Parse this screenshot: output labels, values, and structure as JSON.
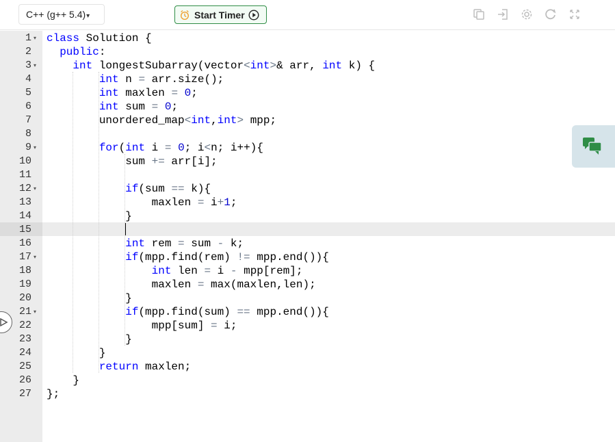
{
  "toolbar": {
    "language": "C++ (g++ 5.4)",
    "language_caret": "▾",
    "timer_label": "Start Timer",
    "icons": [
      "copy-icon",
      "signin-icon",
      "settings-icon",
      "reset-icon",
      "fullscreen-icon"
    ]
  },
  "colors": {
    "keyword": "#0000ff",
    "number": "#0000cd",
    "operator": "#687687",
    "accent_green": "#2f8d46",
    "chat_green": "#2f8d46"
  },
  "editor": {
    "active_line": 15,
    "lines": [
      {
        "n": "1",
        "fold": true,
        "code": "class Solution {"
      },
      {
        "n": "2",
        "fold": false,
        "code": "  public:"
      },
      {
        "n": "3",
        "fold": true,
        "code": "    int longestSubarray(vector<int>& arr, int k) {"
      },
      {
        "n": "4",
        "fold": false,
        "code": "        int n = arr.size();"
      },
      {
        "n": "5",
        "fold": false,
        "code": "        int maxlen = 0;"
      },
      {
        "n": "6",
        "fold": false,
        "code": "        int sum = 0;"
      },
      {
        "n": "7",
        "fold": false,
        "code": "        unordered_map<int,int> mpp;"
      },
      {
        "n": "8",
        "fold": false,
        "code": ""
      },
      {
        "n": "9",
        "fold": true,
        "code": "        for(int i = 0; i<n; i++){"
      },
      {
        "n": "10",
        "fold": false,
        "code": "            sum += arr[i];"
      },
      {
        "n": "11",
        "fold": false,
        "code": ""
      },
      {
        "n": "12",
        "fold": true,
        "code": "            if(sum == k){"
      },
      {
        "n": "13",
        "fold": false,
        "code": "                maxlen = i+1;"
      },
      {
        "n": "14",
        "fold": false,
        "code": "            }"
      },
      {
        "n": "15",
        "fold": false,
        "code": ""
      },
      {
        "n": "16",
        "fold": false,
        "code": "            int rem = sum - k;"
      },
      {
        "n": "17",
        "fold": true,
        "code": "            if(mpp.find(rem) != mpp.end()){"
      },
      {
        "n": "18",
        "fold": false,
        "code": "                int len = i - mpp[rem];"
      },
      {
        "n": "19",
        "fold": false,
        "code": "                maxlen = max(maxlen,len);"
      },
      {
        "n": "20",
        "fold": false,
        "code": "            }"
      },
      {
        "n": "21",
        "fold": true,
        "code": "            if(mpp.find(sum) == mpp.end()){"
      },
      {
        "n": "22",
        "fold": false,
        "code": "                mpp[sum] = i;"
      },
      {
        "n": "23",
        "fold": false,
        "code": "            }"
      },
      {
        "n": "24",
        "fold": false,
        "code": "        }"
      },
      {
        "n": "25",
        "fold": false,
        "code": "        return maxlen;"
      },
      {
        "n": "26",
        "fold": false,
        "code": "    }"
      },
      {
        "n": "27",
        "fold": false,
        "code": "};"
      }
    ]
  }
}
